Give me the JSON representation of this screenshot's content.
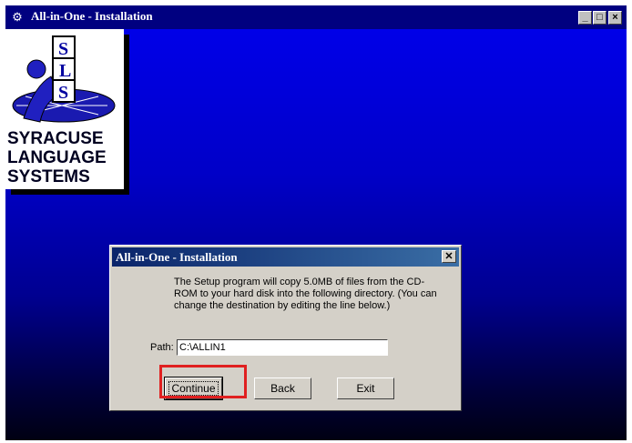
{
  "window": {
    "title": "All-in-One - Installation",
    "icon": "setup-icon",
    "controls": [
      "minimize",
      "maximize",
      "close"
    ]
  },
  "logo": {
    "monogram": [
      "S",
      "L",
      "S"
    ],
    "lines": [
      "SYRACUSE",
      "LANGUAGE",
      "SYSTEMS"
    ]
  },
  "dialog": {
    "title": "All-in-One - Installation",
    "message": "The Setup program will copy 5.0MB of files from the CD-ROM to your hard disk into the following directory. (You can change the destination by editing the line below.)",
    "path_label": "Path:",
    "path_value": "C:\\ALLIN1",
    "buttons": {
      "continue": "Continue",
      "back": "Back",
      "exit": "Exit"
    }
  },
  "colors": {
    "titlebar": "#000080",
    "highlight": "#e02020"
  }
}
